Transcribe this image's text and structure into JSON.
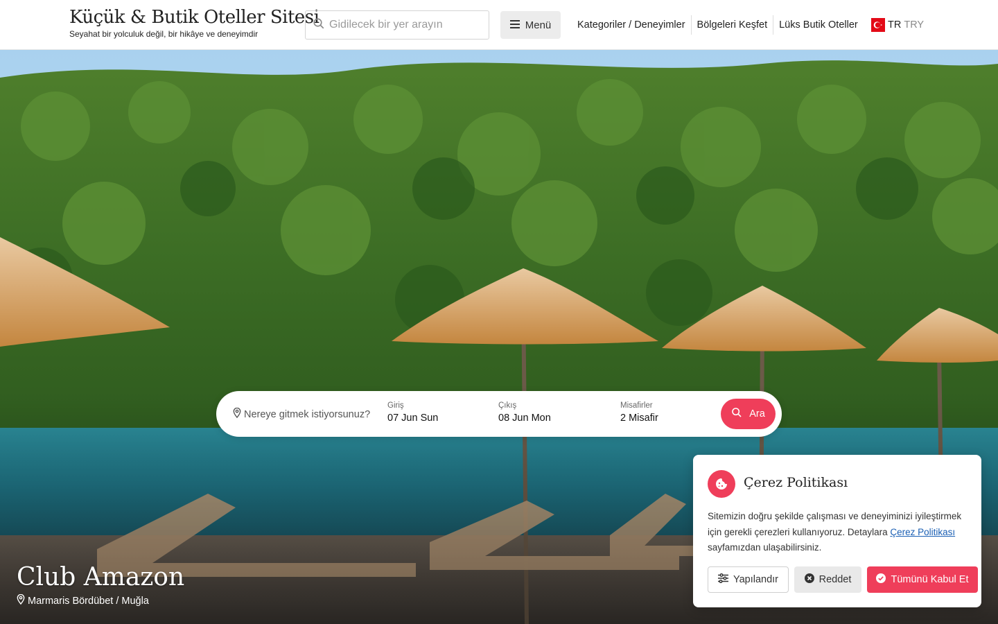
{
  "header": {
    "logo_title": "Küçük & Butik Oteller Sitesi",
    "logo_subtitle": "Seyahat bir yolculuk değil, bir hikâye ve deneyimdir",
    "search_placeholder": "Gidilecek bir yer arayın",
    "menu_label": "Menü",
    "nav": [
      {
        "label": "Kategoriler / Deneyimler"
      },
      {
        "label": "Bölgeleri Keşfet"
      },
      {
        "label": "Lüks Butik Oteller"
      }
    ],
    "language": "TR",
    "currency": "TRY"
  },
  "booking": {
    "destination_placeholder": "Nereye gitmek istiyorsunuz?",
    "checkin_label": "Giriş",
    "checkin_value": "07 Jun Sun",
    "checkout_label": "Çıkış",
    "checkout_value": "08 Jun Mon",
    "guests_label": "Misafirler",
    "guests_value": "2 Misafir",
    "search_label": "Ara"
  },
  "hotel": {
    "name": "Club Amazon",
    "location": "Marmaris Bördübet / Muğla"
  },
  "cookie": {
    "title": "Çerez Politikası",
    "text_before": "Sitemizin doğru şekilde çalışması ve deneyiminizi iyileştirmek için gerekli çerezleri kullanıyoruz. Detaylara ",
    "link": "Çerez Politikası",
    "text_after": " sayfamızdan ulaşabilirsiniz.",
    "configure_label": "Yapılandır",
    "reject_label": "Reddet",
    "accept_label": "Tümünü Kabul Et"
  },
  "colors": {
    "accent": "#ef3e5a",
    "link": "#1a5fb4",
    "flag": "#e30a17"
  },
  "icons": [
    "search-icon",
    "hamburger-icon",
    "turkey-flag-icon",
    "location-pin-icon",
    "cookie-icon",
    "sliders-icon",
    "close-circle-icon",
    "check-circle-icon"
  ]
}
